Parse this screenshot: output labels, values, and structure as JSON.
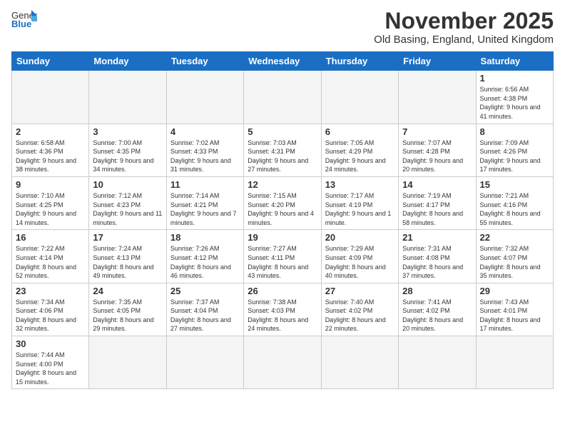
{
  "header": {
    "logo_general": "General",
    "logo_blue": "Blue",
    "month_title": "November 2025",
    "subtitle": "Old Basing, England, United Kingdom"
  },
  "weekdays": [
    "Sunday",
    "Monday",
    "Tuesday",
    "Wednesday",
    "Thursday",
    "Friday",
    "Saturday"
  ],
  "weeks": [
    [
      {
        "day": "",
        "info": ""
      },
      {
        "day": "",
        "info": ""
      },
      {
        "day": "",
        "info": ""
      },
      {
        "day": "",
        "info": ""
      },
      {
        "day": "",
        "info": ""
      },
      {
        "day": "",
        "info": ""
      },
      {
        "day": "1",
        "info": "Sunrise: 6:56 AM\nSunset: 4:38 PM\nDaylight: 9 hours\nand 41 minutes."
      }
    ],
    [
      {
        "day": "2",
        "info": "Sunrise: 6:58 AM\nSunset: 4:36 PM\nDaylight: 9 hours\nand 38 minutes."
      },
      {
        "day": "3",
        "info": "Sunrise: 7:00 AM\nSunset: 4:35 PM\nDaylight: 9 hours\nand 34 minutes."
      },
      {
        "day": "4",
        "info": "Sunrise: 7:02 AM\nSunset: 4:33 PM\nDaylight: 9 hours\nand 31 minutes."
      },
      {
        "day": "5",
        "info": "Sunrise: 7:03 AM\nSunset: 4:31 PM\nDaylight: 9 hours\nand 27 minutes."
      },
      {
        "day": "6",
        "info": "Sunrise: 7:05 AM\nSunset: 4:29 PM\nDaylight: 9 hours\nand 24 minutes."
      },
      {
        "day": "7",
        "info": "Sunrise: 7:07 AM\nSunset: 4:28 PM\nDaylight: 9 hours\nand 20 minutes."
      },
      {
        "day": "8",
        "info": "Sunrise: 7:09 AM\nSunset: 4:26 PM\nDaylight: 9 hours\nand 17 minutes."
      }
    ],
    [
      {
        "day": "9",
        "info": "Sunrise: 7:10 AM\nSunset: 4:25 PM\nDaylight: 9 hours\nand 14 minutes."
      },
      {
        "day": "10",
        "info": "Sunrise: 7:12 AM\nSunset: 4:23 PM\nDaylight: 9 hours\nand 11 minutes."
      },
      {
        "day": "11",
        "info": "Sunrise: 7:14 AM\nSunset: 4:21 PM\nDaylight: 9 hours\nand 7 minutes."
      },
      {
        "day": "12",
        "info": "Sunrise: 7:15 AM\nSunset: 4:20 PM\nDaylight: 9 hours\nand 4 minutes."
      },
      {
        "day": "13",
        "info": "Sunrise: 7:17 AM\nSunset: 4:19 PM\nDaylight: 9 hours\nand 1 minute."
      },
      {
        "day": "14",
        "info": "Sunrise: 7:19 AM\nSunset: 4:17 PM\nDaylight: 8 hours\nand 58 minutes."
      },
      {
        "day": "15",
        "info": "Sunrise: 7:21 AM\nSunset: 4:16 PM\nDaylight: 8 hours\nand 55 minutes."
      }
    ],
    [
      {
        "day": "16",
        "info": "Sunrise: 7:22 AM\nSunset: 4:14 PM\nDaylight: 8 hours\nand 52 minutes."
      },
      {
        "day": "17",
        "info": "Sunrise: 7:24 AM\nSunset: 4:13 PM\nDaylight: 8 hours\nand 49 minutes."
      },
      {
        "day": "18",
        "info": "Sunrise: 7:26 AM\nSunset: 4:12 PM\nDaylight: 8 hours\nand 46 minutes."
      },
      {
        "day": "19",
        "info": "Sunrise: 7:27 AM\nSunset: 4:11 PM\nDaylight: 8 hours\nand 43 minutes."
      },
      {
        "day": "20",
        "info": "Sunrise: 7:29 AM\nSunset: 4:09 PM\nDaylight: 8 hours\nand 40 minutes."
      },
      {
        "day": "21",
        "info": "Sunrise: 7:31 AM\nSunset: 4:08 PM\nDaylight: 8 hours\nand 37 minutes."
      },
      {
        "day": "22",
        "info": "Sunrise: 7:32 AM\nSunset: 4:07 PM\nDaylight: 8 hours\nand 35 minutes."
      }
    ],
    [
      {
        "day": "23",
        "info": "Sunrise: 7:34 AM\nSunset: 4:06 PM\nDaylight: 8 hours\nand 32 minutes."
      },
      {
        "day": "24",
        "info": "Sunrise: 7:35 AM\nSunset: 4:05 PM\nDaylight: 8 hours\nand 29 minutes."
      },
      {
        "day": "25",
        "info": "Sunrise: 7:37 AM\nSunset: 4:04 PM\nDaylight: 8 hours\nand 27 minutes."
      },
      {
        "day": "26",
        "info": "Sunrise: 7:38 AM\nSunset: 4:03 PM\nDaylight: 8 hours\nand 24 minutes."
      },
      {
        "day": "27",
        "info": "Sunrise: 7:40 AM\nSunset: 4:02 PM\nDaylight: 8 hours\nand 22 minutes."
      },
      {
        "day": "28",
        "info": "Sunrise: 7:41 AM\nSunset: 4:02 PM\nDaylight: 8 hours\nand 20 minutes."
      },
      {
        "day": "29",
        "info": "Sunrise: 7:43 AM\nSunset: 4:01 PM\nDaylight: 8 hours\nand 17 minutes."
      }
    ],
    [
      {
        "day": "30",
        "info": "Sunrise: 7:44 AM\nSunset: 4:00 PM\nDaylight: 8 hours\nand 15 minutes."
      },
      {
        "day": "",
        "info": ""
      },
      {
        "day": "",
        "info": ""
      },
      {
        "day": "",
        "info": ""
      },
      {
        "day": "",
        "info": ""
      },
      {
        "day": "",
        "info": ""
      },
      {
        "day": "",
        "info": ""
      }
    ]
  ]
}
